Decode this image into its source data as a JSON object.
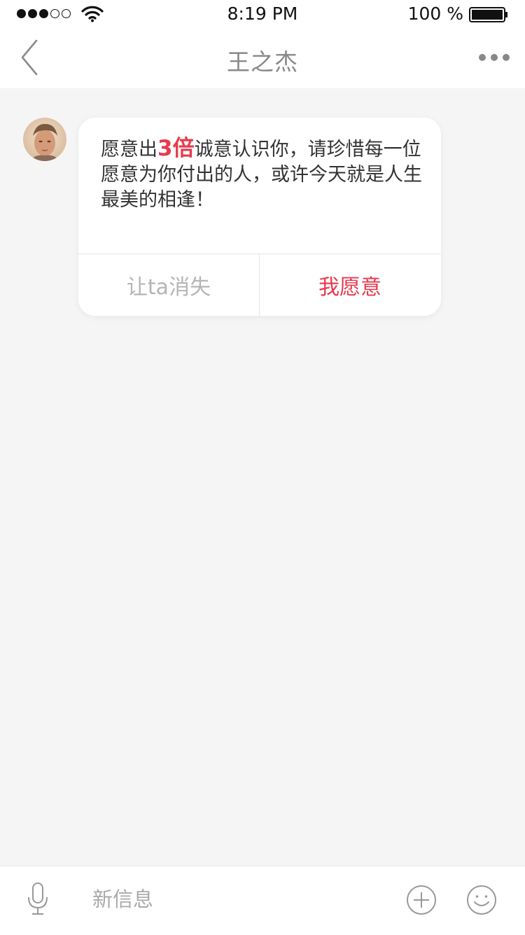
{
  "status_bar": {
    "time": "8:19 PM",
    "battery_percent_text": "100 %",
    "signal_strength_bars": 3,
    "signal_total_bars": 5,
    "battery_level": 1.0
  },
  "nav": {
    "title": "王之杰",
    "back_icon": "chevron-left-icon",
    "more_icon": "more-horizontal-icon"
  },
  "chat": {
    "avatar_icon": "avatar",
    "card": {
      "message_prefix": "愿意出",
      "message_highlight": "3倍",
      "message_suffix": "诚意认识你，请珍惜每一位愿意为你付出的人，或许今天就是人生最美的相逢！",
      "dismiss_label": "让ta消失",
      "accept_label": "我愿意"
    }
  },
  "input_bar": {
    "placeholder": "新信息",
    "mic_icon": "microphone-icon",
    "plus_icon": "plus-circle-icon",
    "emoji_icon": "emoji-icon"
  },
  "colors": {
    "accent": "#e8394d",
    "background": "#f5f5f5"
  }
}
